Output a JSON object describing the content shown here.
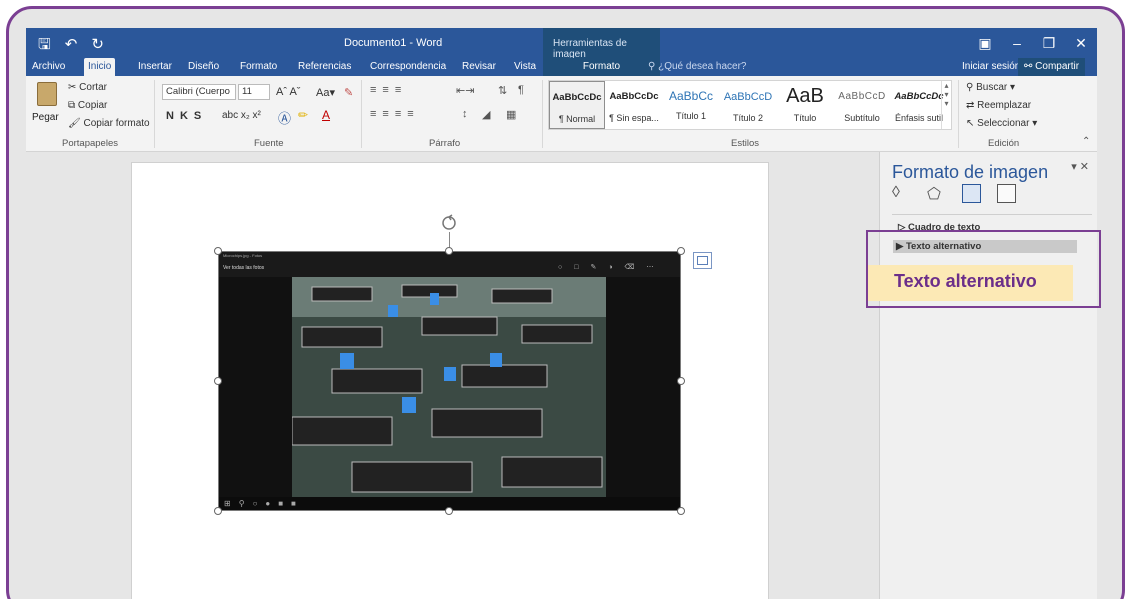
{
  "window": {
    "title": "Documento1 - Word",
    "context_group": "Herramientas de imagen",
    "sign_in": "Iniciar sesión",
    "share": "Compartir"
  },
  "tabs": [
    "Archivo",
    "Inicio",
    "Insertar",
    "Diseño",
    "Formato",
    "Referencias",
    "Correspondencia",
    "Revisar",
    "Vista",
    "Formato"
  ],
  "tell_me": "¿Qué desea hacer?",
  "ribbon": {
    "clipboard": {
      "paste": "Pegar",
      "cut": "Cortar",
      "copy": "Copiar",
      "format_painter": "Copiar formato",
      "label": "Portapapeles"
    },
    "font": {
      "name": "Calibri (Cuerpo",
      "size": "11",
      "label": "Fuente"
    },
    "paragraph": {
      "label": "Párrafo"
    },
    "styles": {
      "label": "Estilos",
      "items": [
        {
          "preview": "AaBbCcDc",
          "name": "¶ Normal"
        },
        {
          "preview": "AaBbCcDc",
          "name": "¶ Sin espa..."
        },
        {
          "preview": "AaBbCc",
          "name": "Título 1"
        },
        {
          "preview": "AaBbCcD",
          "name": "Título 2"
        },
        {
          "preview": "AaB",
          "name": "Título"
        },
        {
          "preview": "AaBbCcD",
          "name": "Subtítulo"
        },
        {
          "preview": "AaBbCcDc",
          "name": "Énfasis sutil"
        }
      ]
    },
    "editing": {
      "find": "Buscar",
      "replace": "Reemplazar",
      "select": "Seleccionar",
      "label": "Edición"
    }
  },
  "photo": {
    "app_title": "Microchips.jpg - Fotos",
    "back": "Ver todas las fotos"
  },
  "pane": {
    "title": "Formato de imagen",
    "sections": [
      "Cuadro de texto",
      "Texto alternativo"
    ]
  },
  "callout": "Texto alternativo",
  "colors": {
    "word_blue": "#2b579a",
    "highlight_purple": "#7b3f93",
    "callout_bg": "#fce9b5"
  }
}
